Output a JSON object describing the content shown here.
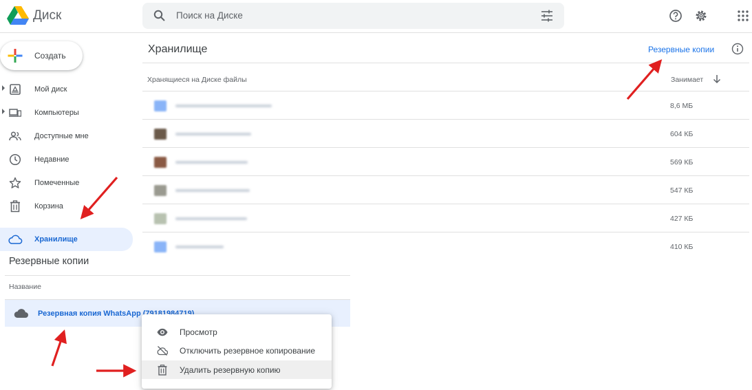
{
  "header": {
    "app_name": "Диск",
    "search_placeholder": "Поиск на Диске"
  },
  "sidebar": {
    "create_label": "Создать",
    "items": [
      {
        "label": "Мой диск",
        "icon": "my-drive-icon"
      },
      {
        "label": "Компьютеры",
        "icon": "computers-icon"
      },
      {
        "label": "Доступные мне",
        "icon": "shared-with-me-icon"
      },
      {
        "label": "Недавние",
        "icon": "clock-icon"
      },
      {
        "label": "Помеченные",
        "icon": "star-icon"
      },
      {
        "label": "Корзина",
        "icon": "trash-icon"
      },
      {
        "label": "Хранилище",
        "icon": "cloud-icon"
      }
    ]
  },
  "storage": {
    "title": "Хранилище",
    "backups_link": "Резервные копии",
    "col_files": "Хранящиеся на Диске файлы",
    "col_size": "Занимает",
    "files": [
      {
        "size": "8,6 МБ"
      },
      {
        "size": "604 КБ"
      },
      {
        "size": "569 КБ"
      },
      {
        "size": "547 КБ"
      },
      {
        "size": "427 КБ"
      },
      {
        "size": "410 КБ"
      }
    ]
  },
  "backups": {
    "title": "Резервные копии",
    "col_name": "Название",
    "item_label": "Резервная копия WhatsApp (79181984719)"
  },
  "context_menu": {
    "items": [
      {
        "label": "Просмотр",
        "icon": "eye-icon"
      },
      {
        "label": "Отключить резервное копирование",
        "icon": "cloud-off-icon"
      },
      {
        "label": "Удалить резервную копию",
        "icon": "trash-icon"
      }
    ]
  },
  "colors": {
    "accent": "#1a73e8",
    "active_bg": "#e8f0fe",
    "annotation_arrow": "#e02020"
  }
}
